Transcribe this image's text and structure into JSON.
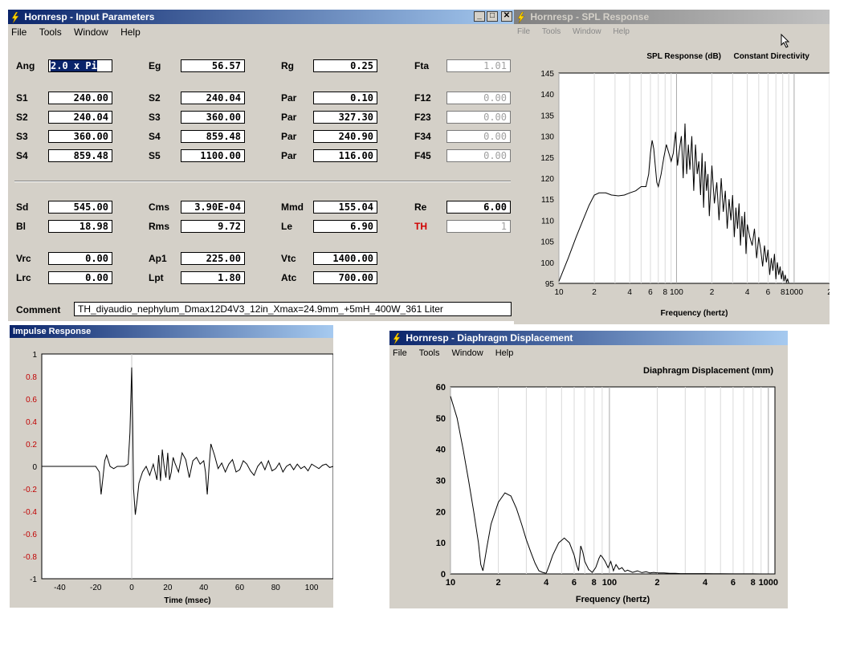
{
  "input_window": {
    "title": "Hornresp - Input Parameters",
    "menu": [
      "File",
      "Tools",
      "Window",
      "Help"
    ],
    "rows": [
      [
        {
          "label": "Ang",
          "value": "2.0 x Pi",
          "selected": true
        },
        {
          "label": "Eg",
          "value": "56.57"
        },
        {
          "label": "Rg",
          "value": "0.25"
        },
        {
          "label": "Fta",
          "value": "1.01",
          "readonly": true
        }
      ],
      [
        {
          "label": "S1",
          "value": "240.00"
        },
        {
          "label": "S2",
          "value": "240.04"
        },
        {
          "label": "Par",
          "value": "0.10"
        },
        {
          "label": "F12",
          "value": "0.00",
          "readonly": true
        }
      ],
      [
        {
          "label": "S2",
          "value": "240.04"
        },
        {
          "label": "S3",
          "value": "360.00"
        },
        {
          "label": "Par",
          "value": "327.30"
        },
        {
          "label": "F23",
          "value": "0.00",
          "readonly": true
        }
      ],
      [
        {
          "label": "S3",
          "value": "360.00"
        },
        {
          "label": "S4",
          "value": "859.48"
        },
        {
          "label": "Par",
          "value": "240.90"
        },
        {
          "label": "F34",
          "value": "0.00",
          "readonly": true
        }
      ],
      [
        {
          "label": "S4",
          "value": "859.48"
        },
        {
          "label": "S5",
          "value": "1100.00"
        },
        {
          "label": "Par",
          "value": "116.00"
        },
        {
          "label": "F45",
          "value": "0.00",
          "readonly": true
        }
      ],
      [
        {
          "label": "Sd",
          "value": "545.00"
        },
        {
          "label": "Cms",
          "value": "3.90E-04"
        },
        {
          "label": "Mmd",
          "value": "155.04"
        },
        {
          "label": "Re",
          "value": "6.00"
        }
      ],
      [
        {
          "label": "Bl",
          "value": "18.98"
        },
        {
          "label": "Rms",
          "value": "9.72"
        },
        {
          "label": "Le",
          "value": "6.90"
        },
        {
          "label": "TH",
          "value": "1",
          "readonly": true,
          "red": true
        }
      ],
      [
        {
          "label": "Vrc",
          "value": "0.00"
        },
        {
          "label": "Ap1",
          "value": "225.00"
        },
        {
          "label": "Vtc",
          "value": "1400.00"
        }
      ],
      [
        {
          "label": "Lrc",
          "value": "0.00"
        },
        {
          "label": "Lpt",
          "value": "1.80"
        },
        {
          "label": "Atc",
          "value": "700.00"
        }
      ]
    ],
    "comment_label": "Comment",
    "comment": "TH_diyaudio_nephylum_Dmax12D4V3_12in_Xmax=24.9mm_+5mH_400W_361 Liter"
  },
  "spl_window": {
    "title": "Hornresp - SPL Response",
    "menu": [
      "File",
      "Tools",
      "Window",
      "Help"
    ]
  },
  "impulse_window": {
    "title": "Impulse Response"
  },
  "disp_window": {
    "title": "Hornresp - Diaphragm Displacement",
    "menu": [
      "File",
      "Tools",
      "Window",
      "Help"
    ]
  },
  "colors": {
    "title_active": "#0a246a",
    "title_inactive": "#808080",
    "face": "#d4d0c8",
    "red_label": "#d00000"
  },
  "chart_data": [
    {
      "type": "line",
      "title": "SPL Response (dB)",
      "subtitle": "Constant Directivity",
      "xlabel": "Frequency (hertz)",
      "ylabel": "",
      "x_scale": "log",
      "xlim": [
        10,
        2000
      ],
      "ylim": [
        95,
        145
      ],
      "y_ticks": [
        145,
        140,
        135,
        130,
        125,
        120,
        115,
        110,
        105,
        100,
        95
      ],
      "x_ticks": [
        {
          "v": 10,
          "t": "10"
        },
        {
          "v": 20,
          "t": "2"
        },
        {
          "v": 40,
          "t": "4"
        },
        {
          "v": 60,
          "t": "6"
        },
        {
          "v": 80,
          "t": "8"
        },
        {
          "v": 100,
          "t": "100"
        },
        {
          "v": 200,
          "t": "2"
        },
        {
          "v": 400,
          "t": "4"
        },
        {
          "v": 600,
          "t": "6"
        },
        {
          "v": 800,
          "t": "8"
        },
        {
          "v": 1000,
          "t": "1000"
        },
        {
          "v": 2000,
          "t": "2"
        }
      ],
      "x": [
        10,
        12,
        14,
        16,
        18,
        20,
        22,
        25,
        28,
        32,
        36,
        40,
        45,
        50,
        55,
        58,
        60,
        62,
        64,
        66,
        68,
        70,
        74,
        78,
        82,
        86,
        90,
        94,
        98,
        102,
        106,
        110,
        114,
        118,
        122,
        126,
        130,
        135,
        140,
        145,
        150,
        155,
        160,
        165,
        170,
        175,
        180,
        185,
        190,
        200,
        210,
        220,
        230,
        240,
        250,
        260,
        270,
        280,
        290,
        300,
        310,
        320,
        330,
        340,
        350,
        360,
        370,
        380,
        390,
        400,
        420,
        440,
        460,
        480,
        500,
        520,
        540,
        560,
        580,
        600,
        620,
        640,
        660,
        680,
        700,
        720,
        740,
        760,
        780,
        800,
        820,
        840,
        860,
        880,
        900
      ],
      "values": [
        95.5,
        101,
        106,
        110,
        113.5,
        116,
        116.5,
        116.5,
        116,
        115.8,
        116,
        116.5,
        117,
        118,
        118,
        121,
        126,
        129,
        127,
        123,
        119,
        118,
        121,
        125,
        128,
        126,
        124,
        126,
        131,
        123,
        127,
        130,
        120,
        133,
        121,
        128,
        122,
        130,
        117,
        128,
        121,
        124,
        116,
        126,
        113,
        124,
        117,
        121,
        111,
        123,
        114,
        119,
        110,
        120,
        112,
        117,
        108,
        115,
        110,
        116,
        106,
        113,
        108,
        114,
        104,
        111,
        106,
        112,
        102,
        109,
        106,
        104,
        108,
        101,
        106,
        103,
        99,
        104,
        100,
        103,
        97,
        101,
        98,
        102,
        96,
        100,
        97,
        99,
        96,
        98,
        95.5,
        97,
        95.3,
        96,
        95
      ]
    },
    {
      "type": "line",
      "title": "",
      "xlabel": "Time (msec)",
      "ylabel": "",
      "xlim": [
        -50,
        112
      ],
      "ylim": [
        -1,
        1
      ],
      "x_ticks": [
        -40,
        -20,
        0,
        20,
        40,
        60,
        80,
        100
      ],
      "y_ticks": [
        {
          "v": 1,
          "t": "1"
        },
        {
          "v": 0.8,
          "t": "0.8"
        },
        {
          "v": 0.6,
          "t": "0.6"
        },
        {
          "v": 0.4,
          "t": "0.4"
        },
        {
          "v": 0.2,
          "t": "0.2"
        },
        {
          "v": 0,
          "t": "0"
        },
        {
          "v": -0.2,
          "t": "-0.2"
        },
        {
          "v": -0.4,
          "t": "-0.4"
        },
        {
          "v": -0.6,
          "t": "-0.6"
        },
        {
          "v": -0.8,
          "t": "-0.8"
        },
        {
          "v": -1,
          "t": "-1"
        }
      ],
      "x": [
        -50,
        -20,
        -18,
        -17,
        -16,
        -15,
        -14,
        -13,
        -12,
        -10,
        -8,
        -6,
        -4,
        -2,
        -1,
        0,
        0.5,
        1,
        2,
        3,
        4,
        5,
        6,
        8,
        10,
        12,
        14,
        15,
        16,
        17,
        18,
        19,
        20,
        21,
        22,
        23,
        24,
        26,
        28,
        30,
        32,
        34,
        36,
        38,
        40,
        41,
        42,
        43,
        44,
        46,
        48,
        50,
        52,
        54,
        56,
        58,
        60,
        62,
        64,
        66,
        68,
        70,
        72,
        74,
        76,
        78,
        80,
        82,
        84,
        86,
        88,
        90,
        92,
        94,
        96,
        98,
        100,
        102,
        104,
        106,
        108,
        110,
        112
      ],
      "values": [
        0,
        0,
        -0.05,
        -0.25,
        -0.1,
        0.05,
        0.1,
        0.05,
        0,
        -0.02,
        0.0,
        0.0,
        0.0,
        0.02,
        0.3,
        0.88,
        0.4,
        -0.2,
        -0.43,
        -0.3,
        -0.15,
        -0.1,
        -0.05,
        0.0,
        -0.08,
        0.02,
        -0.12,
        0.1,
        -0.13,
        0.15,
        0.0,
        -0.1,
        0.12,
        -0.12,
        -0.05,
        0.08,
        0.03,
        -0.05,
        0.12,
        0.06,
        -0.1,
        0.05,
        0.08,
        0.02,
        0.05,
        -0.05,
        -0.25,
        0.0,
        0.2,
        0.1,
        -0.02,
        0.03,
        -0.05,
        0.02,
        0.06,
        -0.05,
        -0.03,
        0.05,
        0.02,
        -0.04,
        -0.08,
        0.0,
        0.04,
        -0.03,
        0.05,
        -0.04,
        -0.02,
        0.03,
        -0.05,
        0.0,
        0.02,
        -0.03,
        0.02,
        -0.02,
        0.0,
        -0.04,
        0.02,
        0.0,
        -0.02,
        0.01,
        0.02,
        -0.01,
        0.0
      ]
    },
    {
      "type": "line",
      "title": "Diaphragm Displacement (mm)",
      "xlabel": "Frequency (hertz)",
      "ylabel": "",
      "x_scale": "log",
      "xlim": [
        10,
        1100
      ],
      "ylim": [
        0,
        60
      ],
      "y_ticks": [
        60,
        50,
        40,
        30,
        20,
        10,
        0
      ],
      "x_ticks": [
        {
          "v": 10,
          "t": "10"
        },
        {
          "v": 20,
          "t": "2"
        },
        {
          "v": 40,
          "t": "4"
        },
        {
          "v": 60,
          "t": "6"
        },
        {
          "v": 80,
          "t": "8"
        },
        {
          "v": 100,
          "t": "100"
        },
        {
          "v": 200,
          "t": "2"
        },
        {
          "v": 400,
          "t": "4"
        },
        {
          "v": 600,
          "t": "6"
        },
        {
          "v": 800,
          "t": "8"
        },
        {
          "v": 1000,
          "t": "1000"
        }
      ],
      "x": [
        10,
        11,
        12,
        13,
        14,
        15,
        15.5,
        16,
        17,
        18,
        20,
        22,
        24,
        26,
        28,
        30,
        32,
        34,
        36,
        38,
        40,
        42,
        44,
        48,
        52,
        56,
        60,
        62,
        64,
        66,
        68,
        70,
        74,
        78,
        82,
        84,
        86,
        88,
        90,
        94,
        98,
        102,
        106,
        110,
        115,
        120,
        125,
        130,
        140,
        150,
        160,
        170,
        180,
        190,
        200,
        220,
        240,
        260,
        280,
        300,
        350,
        400,
        450,
        500,
        600,
        700,
        800,
        900,
        1000,
        1100
      ],
      "values": [
        57,
        50,
        40,
        30,
        20,
        10,
        3,
        1,
        9,
        16,
        23,
        26,
        25,
        21,
        16,
        11,
        7,
        3.5,
        1,
        0.5,
        0.2,
        3,
        6,
        10,
        11.5,
        10,
        6,
        3,
        1,
        9,
        7,
        4,
        1.5,
        0.5,
        2,
        3.5,
        5,
        6,
        5.5,
        4,
        2,
        4,
        1,
        3,
        1.5,
        2,
        0.8,
        1.2,
        0.5,
        1,
        0.4,
        0.7,
        0.3,
        0.5,
        0.3,
        0.3,
        0.2,
        0.2,
        0.1,
        0.1,
        0.1,
        0.1,
        0.05,
        0.05,
        0.03,
        0.02,
        0.02,
        0.01,
        0.01,
        0.01
      ]
    }
  ]
}
